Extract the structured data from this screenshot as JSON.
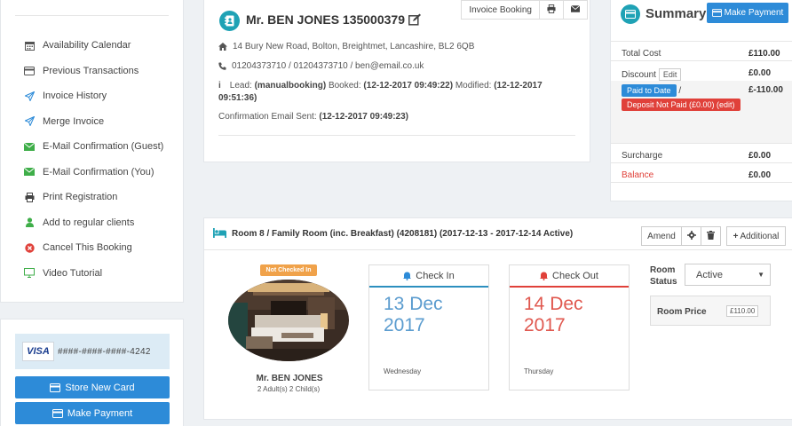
{
  "menu": {
    "items": [
      {
        "label": "Availability Calendar",
        "icon": "calendar-icon",
        "color": "#555555"
      },
      {
        "label": "Previous Transactions",
        "icon": "credit-card-icon",
        "color": "#555555"
      },
      {
        "label": "Invoice History",
        "icon": "paper-plane-icon",
        "color": "#2d8bd8"
      },
      {
        "label": "Merge Invoice",
        "icon": "paper-plane-icon",
        "color": "#2d8bd8"
      },
      {
        "label": "E-Mail Confirmation (Guest)",
        "icon": "envelope-icon",
        "color": "#3fae49"
      },
      {
        "label": "E-Mail Confirmation (You)",
        "icon": "envelope-icon",
        "color": "#3fae49"
      },
      {
        "label": "Print Registration",
        "icon": "print-icon",
        "color": "#555555"
      },
      {
        "label": "Add to regular clients",
        "icon": "user-icon",
        "color": "#3fae49"
      },
      {
        "label": "Cancel This Booking",
        "icon": "cancel-icon",
        "color": "#e0413a"
      },
      {
        "label": "Video Tutorial",
        "icon": "monitor-icon",
        "color": "#3fae49"
      }
    ]
  },
  "card": {
    "brand": "VISA",
    "number": "####-####-####-4242",
    "store_label": "Store New Card",
    "pay_label": "Make Payment"
  },
  "guest": {
    "toolbar": {
      "invoice_label": "Invoice Booking"
    },
    "name": "Mr. BEN JONES 135000379",
    "address": "14 Bury New Road, Bolton, Breightmet, Lancashire, BL2 6QB",
    "contact": "01204373710 / 01204373710 / ben@email.co.uk",
    "lead_prefix": "Lead:",
    "lead_value": "(manualbooking)",
    "booked_prefix": "Booked:",
    "booked_value": "(12-12-2017 09:49:22)",
    "modified_prefix": "Modified:",
    "modified_value": "(12-12-2017 09:51:36)",
    "confirm_prefix": "Confirmation Email Sent:",
    "confirm_value": "(12-12-2017 09:49:23)"
  },
  "summary": {
    "title": "Summary",
    "pay_label": "Make Payment",
    "total_label": "Total Cost",
    "total_value": "£110.00",
    "discount_label": "Discount",
    "edit_label": "Edit",
    "discount_value": "£0.00",
    "paid_label": "Paid to Date",
    "paid_sep": "/",
    "paid_value": "£-110.00",
    "deposit_label": "Deposit Not Paid (£0.00) (edit)",
    "surcharge_label": "Surcharge",
    "surcharge_value": "£0.00",
    "balance_label": "Balance",
    "balance_value": "£0.00"
  },
  "room": {
    "title": "Room 8 / Family Room (inc. Breakfast) (4208181) (2017-12-13 - 2017-12-14 Active)",
    "amend_label": "Amend",
    "additional_label": "Additional",
    "status_badge": "Not Checked In",
    "guest_name": "Mr. BEN JONES",
    "guest_sub": "2 Adult(s) 2 Child(s)",
    "checkin": {
      "label": "Check In",
      "day": "13 Dec",
      "year": "2017",
      "weekday": "Wednesday",
      "color": "#2c8fbf"
    },
    "checkout": {
      "label": "Check Out",
      "day": "14 Dec",
      "year": "2017",
      "weekday": "Thursday",
      "color": "#e0413a"
    },
    "status_label": "Room Status",
    "status_value": "Active",
    "price_label": "Room Price",
    "price_value": "£110.00"
  }
}
